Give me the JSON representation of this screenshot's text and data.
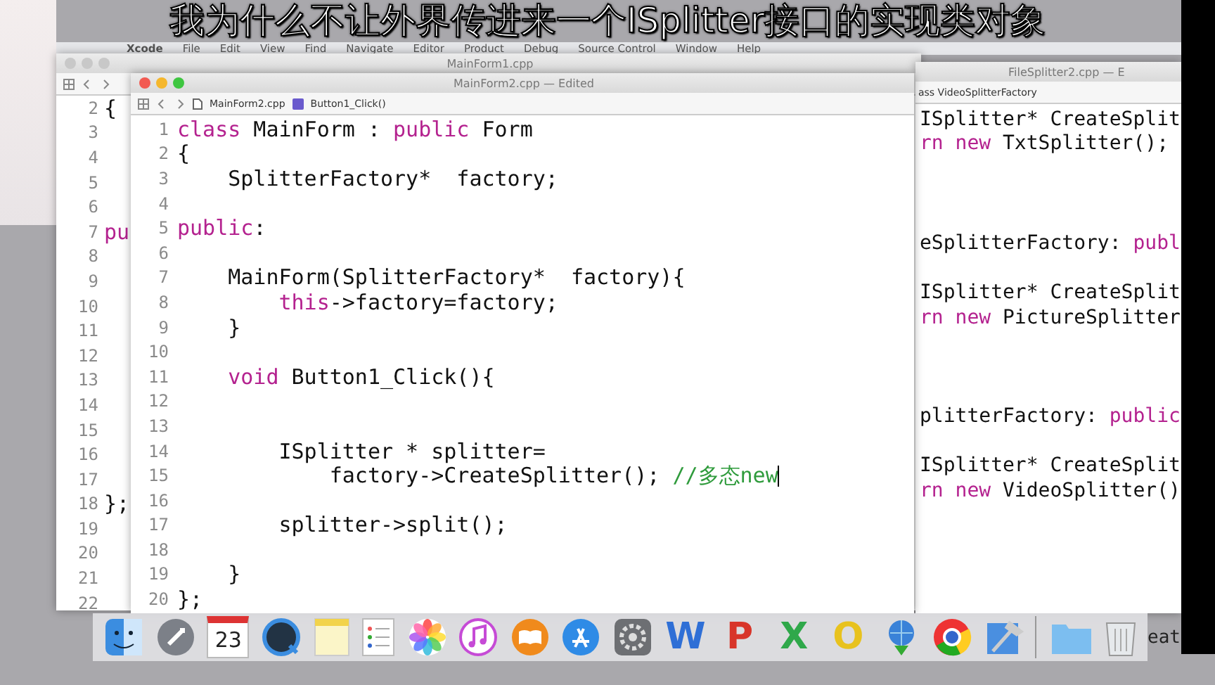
{
  "subtitle": "我为什么不让外界传进来一个ISplitter接口的实现类对象",
  "menu_bar": {
    "items": [
      "Xcode",
      "File",
      "Edit",
      "View",
      "Find",
      "Navigate",
      "Editor",
      "Product",
      "Debug",
      "Source Control",
      "Window",
      "Help"
    ]
  },
  "back_window": {
    "title": "MainForm1.cpp",
    "lines": [
      {
        "number": "2",
        "tokens": [
          {
            "kind": "plain",
            "text": "{"
          }
        ]
      },
      {
        "number": "3"
      },
      {
        "number": "4"
      },
      {
        "number": "5"
      },
      {
        "number": "6"
      },
      {
        "number": "7",
        "tokens": [
          {
            "kind": "keyword",
            "text": "pu"
          }
        ]
      },
      {
        "number": "8"
      },
      {
        "number": "9"
      },
      {
        "number": "10"
      },
      {
        "number": "11"
      },
      {
        "number": "12"
      },
      {
        "number": "13"
      },
      {
        "number": "14"
      },
      {
        "number": "15"
      },
      {
        "number": "16"
      },
      {
        "number": "17"
      },
      {
        "number": "18",
        "tokens": [
          {
            "kind": "plain",
            "text": "};"
          }
        ]
      },
      {
        "number": "19"
      },
      {
        "number": "20"
      },
      {
        "number": "21"
      },
      {
        "number": "22"
      }
    ]
  },
  "right_window": {
    "title": "FileSplitter2.cpp — E",
    "breadcrumb": "ass VideoSplitterFactory",
    "lines": [
      {
        "kind": "code",
        "tokens": [
          {
            "kind": "plain",
            "text": "ISplitter* CreateSplit"
          }
        ]
      },
      {
        "kind": "code",
        "tokens": [
          {
            "kind": "keyword",
            "text": "rn new"
          },
          {
            "kind": "plain",
            "text": " TxtSplitter();"
          }
        ]
      },
      {
        "kind": "blank"
      },
      {
        "kind": "blank"
      },
      {
        "kind": "blank"
      },
      {
        "kind": "code",
        "tokens": [
          {
            "kind": "plain",
            "text": "eSplitterFactory: "
          },
          {
            "kind": "keyword",
            "text": "publ"
          }
        ]
      },
      {
        "kind": "blank"
      },
      {
        "kind": "code",
        "tokens": [
          {
            "kind": "plain",
            "text": "ISplitter* CreateSplit"
          }
        ]
      },
      {
        "kind": "code",
        "tokens": [
          {
            "kind": "keyword",
            "text": "rn new"
          },
          {
            "kind": "plain",
            "text": " PictureSplitter"
          }
        ]
      },
      {
        "kind": "blank"
      },
      {
        "kind": "blank"
      },
      {
        "kind": "blank"
      },
      {
        "kind": "code",
        "tokens": [
          {
            "kind": "plain",
            "text": "plitterFactory: "
          },
          {
            "kind": "keyword",
            "text": "public"
          }
        ]
      },
      {
        "kind": "blank"
      },
      {
        "kind": "code",
        "tokens": [
          {
            "kind": "plain",
            "text": "ISplitter* CreateSplit"
          }
        ]
      },
      {
        "kind": "code",
        "tokens": [
          {
            "kind": "keyword",
            "text": "rn new"
          },
          {
            "kind": "plain",
            "text": " VideoSplitter()"
          }
        ]
      }
    ]
  },
  "editor": {
    "title": "MainForm2.cpp — Edited",
    "breadcrumbs": [
      {
        "kind": "file",
        "text": "MainForm2.cpp"
      },
      {
        "kind": "method",
        "text": "Button1_Click()"
      }
    ],
    "lines": [
      {
        "number": "1",
        "tokens": [
          {
            "kind": "keyword",
            "text": "class"
          },
          {
            "kind": "plain",
            "text": " MainForm : "
          },
          {
            "kind": "keyword",
            "text": "public"
          },
          {
            "kind": "plain",
            "text": " Form"
          }
        ]
      },
      {
        "number": "2",
        "tokens": [
          {
            "kind": "plain",
            "text": "{"
          }
        ]
      },
      {
        "number": "3",
        "tokens": [
          {
            "kind": "plain",
            "text": "    SplitterFactory*  factory;"
          }
        ]
      },
      {
        "number": "4"
      },
      {
        "number": "5",
        "tokens": [
          {
            "kind": "keyword",
            "text": "public"
          },
          {
            "kind": "plain",
            "text": ":"
          }
        ]
      },
      {
        "number": "6"
      },
      {
        "number": "7",
        "tokens": [
          {
            "kind": "plain",
            "text": "    MainForm(SplitterFactory*  factory){"
          }
        ]
      },
      {
        "number": "8",
        "tokens": [
          {
            "kind": "keyword",
            "text": "        this"
          },
          {
            "kind": "plain",
            "text": "->factory=factory;"
          }
        ]
      },
      {
        "number": "9",
        "tokens": [
          {
            "kind": "plain",
            "text": "    }"
          }
        ]
      },
      {
        "number": "10"
      },
      {
        "number": "11",
        "tokens": [
          {
            "kind": "keyword",
            "text": "    void"
          },
          {
            "kind": "plain",
            "text": " Button1_Click(){"
          }
        ]
      },
      {
        "number": "12"
      },
      {
        "number": "13"
      },
      {
        "number": "14",
        "tokens": [
          {
            "kind": "plain",
            "text": "        ISplitter * splitter="
          }
        ]
      },
      {
        "number": "15",
        "cursor": true,
        "tokens": [
          {
            "kind": "plain",
            "text": "            factory->CreateSplitter(); "
          },
          {
            "kind": "comment",
            "text": "//多态new"
          }
        ]
      },
      {
        "number": "16"
      },
      {
        "number": "17",
        "tokens": [
          {
            "kind": "plain",
            "text": "        splitter->split();"
          }
        ]
      },
      {
        "number": "18"
      },
      {
        "number": "19",
        "tokens": [
          {
            "kind": "plain",
            "text": "    }"
          }
        ]
      },
      {
        "number": "20",
        "tokens": [
          {
            "kind": "plain",
            "text": "};"
          }
        ]
      }
    ]
  },
  "dock": [
    {
      "kind": "finder"
    },
    {
      "kind": "launchpad"
    },
    {
      "kind": "calendar",
      "text": "23"
    },
    {
      "kind": "quicktime"
    },
    {
      "kind": "notes"
    },
    {
      "kind": "reminders"
    },
    {
      "kind": "photos"
    },
    {
      "kind": "music"
    },
    {
      "kind": "books"
    },
    {
      "kind": "appstore"
    },
    {
      "kind": "preferences"
    },
    {
      "kind": "letter",
      "text": "W",
      "color": "#2f6fd6"
    },
    {
      "kind": "letter",
      "text": "P",
      "color": "#d8352a"
    },
    {
      "kind": "letter",
      "text": "X",
      "color": "#2fa84a"
    },
    {
      "kind": "letter",
      "text": "O",
      "color": "#e8c21e"
    },
    {
      "kind": "globe"
    },
    {
      "kind": "chrome"
    },
    {
      "kind": "xcode"
    },
    {
      "kind": "separator"
    },
    {
      "kind": "folder"
    },
    {
      "kind": "trash"
    }
  ],
  "desktop_fragment": "eat"
}
